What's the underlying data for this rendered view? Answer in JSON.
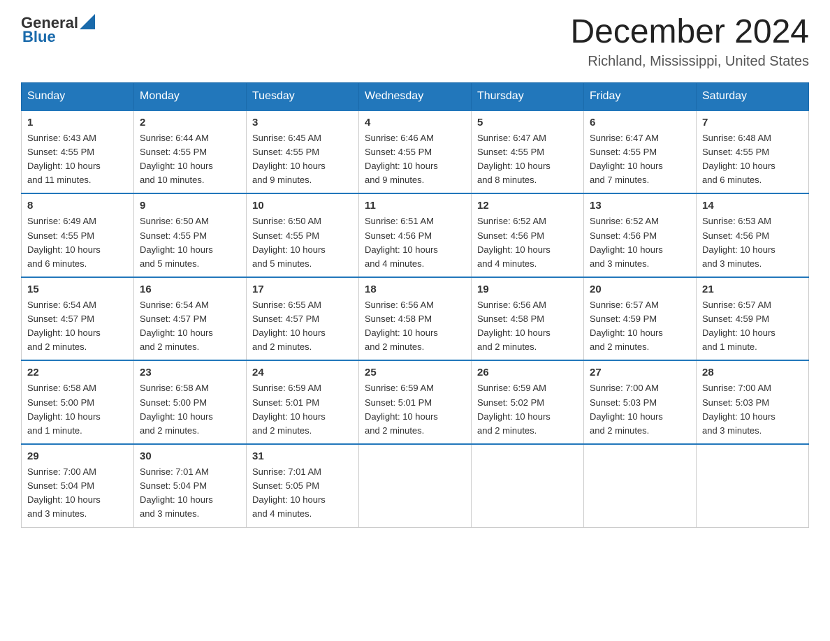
{
  "logo": {
    "general": "General",
    "blue": "Blue"
  },
  "header": {
    "title": "December 2024",
    "subtitle": "Richland, Mississippi, United States"
  },
  "days_of_week": [
    "Sunday",
    "Monday",
    "Tuesday",
    "Wednesday",
    "Thursday",
    "Friday",
    "Saturday"
  ],
  "weeks": [
    [
      {
        "day": "1",
        "sunrise": "6:43 AM",
        "sunset": "4:55 PM",
        "daylight": "10 hours and 11 minutes."
      },
      {
        "day": "2",
        "sunrise": "6:44 AM",
        "sunset": "4:55 PM",
        "daylight": "10 hours and 10 minutes."
      },
      {
        "day": "3",
        "sunrise": "6:45 AM",
        "sunset": "4:55 PM",
        "daylight": "10 hours and 9 minutes."
      },
      {
        "day": "4",
        "sunrise": "6:46 AM",
        "sunset": "4:55 PM",
        "daylight": "10 hours and 9 minutes."
      },
      {
        "day": "5",
        "sunrise": "6:47 AM",
        "sunset": "4:55 PM",
        "daylight": "10 hours and 8 minutes."
      },
      {
        "day": "6",
        "sunrise": "6:47 AM",
        "sunset": "4:55 PM",
        "daylight": "10 hours and 7 minutes."
      },
      {
        "day": "7",
        "sunrise": "6:48 AM",
        "sunset": "4:55 PM",
        "daylight": "10 hours and 6 minutes."
      }
    ],
    [
      {
        "day": "8",
        "sunrise": "6:49 AM",
        "sunset": "4:55 PM",
        "daylight": "10 hours and 6 minutes."
      },
      {
        "day": "9",
        "sunrise": "6:50 AM",
        "sunset": "4:55 PM",
        "daylight": "10 hours and 5 minutes."
      },
      {
        "day": "10",
        "sunrise": "6:50 AM",
        "sunset": "4:55 PM",
        "daylight": "10 hours and 5 minutes."
      },
      {
        "day": "11",
        "sunrise": "6:51 AM",
        "sunset": "4:56 PM",
        "daylight": "10 hours and 4 minutes."
      },
      {
        "day": "12",
        "sunrise": "6:52 AM",
        "sunset": "4:56 PM",
        "daylight": "10 hours and 4 minutes."
      },
      {
        "day": "13",
        "sunrise": "6:52 AM",
        "sunset": "4:56 PM",
        "daylight": "10 hours and 3 minutes."
      },
      {
        "day": "14",
        "sunrise": "6:53 AM",
        "sunset": "4:56 PM",
        "daylight": "10 hours and 3 minutes."
      }
    ],
    [
      {
        "day": "15",
        "sunrise": "6:54 AM",
        "sunset": "4:57 PM",
        "daylight": "10 hours and 2 minutes."
      },
      {
        "day": "16",
        "sunrise": "6:54 AM",
        "sunset": "4:57 PM",
        "daylight": "10 hours and 2 minutes."
      },
      {
        "day": "17",
        "sunrise": "6:55 AM",
        "sunset": "4:57 PM",
        "daylight": "10 hours and 2 minutes."
      },
      {
        "day": "18",
        "sunrise": "6:56 AM",
        "sunset": "4:58 PM",
        "daylight": "10 hours and 2 minutes."
      },
      {
        "day": "19",
        "sunrise": "6:56 AM",
        "sunset": "4:58 PM",
        "daylight": "10 hours and 2 minutes."
      },
      {
        "day": "20",
        "sunrise": "6:57 AM",
        "sunset": "4:59 PM",
        "daylight": "10 hours and 2 minutes."
      },
      {
        "day": "21",
        "sunrise": "6:57 AM",
        "sunset": "4:59 PM",
        "daylight": "10 hours and 1 minute."
      }
    ],
    [
      {
        "day": "22",
        "sunrise": "6:58 AM",
        "sunset": "5:00 PM",
        "daylight": "10 hours and 1 minute."
      },
      {
        "day": "23",
        "sunrise": "6:58 AM",
        "sunset": "5:00 PM",
        "daylight": "10 hours and 2 minutes."
      },
      {
        "day": "24",
        "sunrise": "6:59 AM",
        "sunset": "5:01 PM",
        "daylight": "10 hours and 2 minutes."
      },
      {
        "day": "25",
        "sunrise": "6:59 AM",
        "sunset": "5:01 PM",
        "daylight": "10 hours and 2 minutes."
      },
      {
        "day": "26",
        "sunrise": "6:59 AM",
        "sunset": "5:02 PM",
        "daylight": "10 hours and 2 minutes."
      },
      {
        "day": "27",
        "sunrise": "7:00 AM",
        "sunset": "5:03 PM",
        "daylight": "10 hours and 2 minutes."
      },
      {
        "day": "28",
        "sunrise": "7:00 AM",
        "sunset": "5:03 PM",
        "daylight": "10 hours and 3 minutes."
      }
    ],
    [
      {
        "day": "29",
        "sunrise": "7:00 AM",
        "sunset": "5:04 PM",
        "daylight": "10 hours and 3 minutes."
      },
      {
        "day": "30",
        "sunrise": "7:01 AM",
        "sunset": "5:04 PM",
        "daylight": "10 hours and 3 minutes."
      },
      {
        "day": "31",
        "sunrise": "7:01 AM",
        "sunset": "5:05 PM",
        "daylight": "10 hours and 4 minutes."
      },
      null,
      null,
      null,
      null
    ]
  ],
  "labels": {
    "sunrise": "Sunrise:",
    "sunset": "Sunset:",
    "daylight": "Daylight:"
  }
}
